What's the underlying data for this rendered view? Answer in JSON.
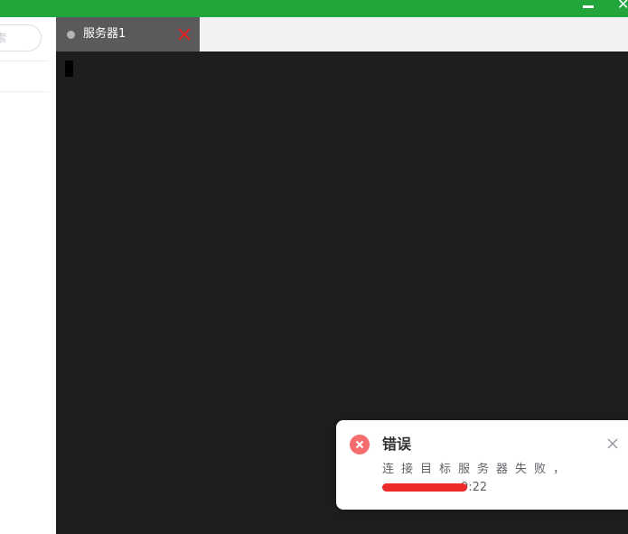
{
  "sidebar": {
    "search_placeholder": "索"
  },
  "tabs": [
    {
      "label": "服务器1",
      "status_icon": "dot-icon",
      "close_icon": "close-icon",
      "close_color": "#e02020"
    }
  ],
  "notification": {
    "type": "error",
    "icon": "error-circle-icon",
    "title": "错误",
    "message": "连接目标服务器失败，",
    "address_suffix": "9:22",
    "close_icon": "close-icon"
  },
  "colors": {
    "titlebar": "#22a63c",
    "terminal_bg": "#1e1e1e",
    "error": "#f56c6c"
  }
}
